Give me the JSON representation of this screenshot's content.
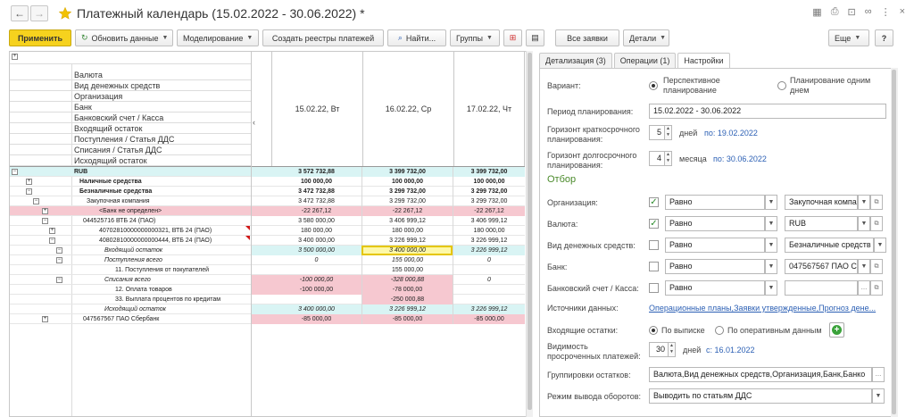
{
  "window": {
    "title": "Платежный календарь (15.02.2022 - 30.06.2022) *"
  },
  "toolbar": {
    "apply": "Применить",
    "refresh": "Обновить данные",
    "modeling": "Моделирование",
    "create_registers": "Создать реестры платежей",
    "find": "Найти...",
    "groups": "Группы",
    "all_requests": "Все заявки",
    "details": "Детали",
    "more": "Еще",
    "help": "?"
  },
  "grid": {
    "header_rows": [
      "Валюта",
      "Вид денежных средств",
      "Организация",
      "Банк",
      "Банковский счет / Касса",
      "Входящий остаток",
      "Поступления / Статья ДДС",
      "Списания / Статья ДДС",
      "Исходящий остаток"
    ],
    "dates": [
      "15.02.22, Вт",
      "16.02.22, Ср",
      "17.02.22, Чт"
    ],
    "rows": [
      {
        "label": "RUB",
        "v1": "3 572 732,88",
        "v2": "3 399 732,00",
        "v3": "3 399 732,00"
      },
      {
        "label": "Наличные средства",
        "v1": "100 000,00",
        "v2": "100 000,00",
        "v3": "100 000,00"
      },
      {
        "label": "Безналичные средства",
        "v1": "3 472 732,88",
        "v2": "3 299 732,00",
        "v3": "3 299 732,00"
      },
      {
        "label": "Закупочная компания",
        "v1": "3 472 732,88",
        "v2": "3 299 732,00",
        "v3": "3 299 732,00"
      },
      {
        "label": "<Банк не определен>",
        "v1": "-22 267,12",
        "v2": "-22 267,12",
        "v3": "-22 267,12"
      },
      {
        "label": "044525716 ВТБ 24 (ПАО)",
        "v1": "3 580 000,00",
        "v2": "3 406 999,12",
        "v3": "3 406 999,12"
      },
      {
        "label": "40702810000000000321, ВТБ 24 (ПАО)",
        "v1": "180 000,00",
        "v2": "180 000,00",
        "v3": "180 000,00"
      },
      {
        "label": "40802810000000000444, ВТБ 24 (ПАО)",
        "v1": "3 400 000,00",
        "v2": "3 226 999,12",
        "v3": "3 226 999,12"
      },
      {
        "label": "Входящий остаток",
        "v1": "3 500 000,00",
        "v2": "3 400 000,00",
        "v3": "3 226 999,12"
      },
      {
        "label": "Поступления всего",
        "v1": "0",
        "v2": "155 000,00",
        "v3": "0"
      },
      {
        "label": "11. Поступления от покупателей",
        "v1": "",
        "v2": "155 000,00",
        "v3": ""
      },
      {
        "label": "Списания всего",
        "v1": "-100 000,00",
        "v2": "-328 000,88",
        "v3": "0"
      },
      {
        "label": "12. Оплата товаров",
        "v1": "-100 000,00",
        "v2": "-78 000,00",
        "v3": ""
      },
      {
        "label": "33. Выплата процентов по кредитам",
        "v1": "",
        "v2": "-250 000,88",
        "v3": ""
      },
      {
        "label": "Исходящий остаток",
        "v1": "3 400 000,00",
        "v2": "3 226 999,12",
        "v3": "3 226 999,12"
      },
      {
        "label": "047567567 ПАО Сбербанк",
        "v1": "-85 000,00",
        "v2": "-85 000,00",
        "v3": "-85 000,00"
      }
    ]
  },
  "panel": {
    "tabs": [
      "Детализация (3)",
      "Операции (1)",
      "Настройки"
    ],
    "variant_label": "Вариант:",
    "variant_opt1": "Перспективное планирование",
    "variant_opt2": "Планирование одним днем",
    "period_label": "Период планирования:",
    "period_value": "15.02.2022 - 30.06.2022",
    "short_label": "Горизонт краткосрочного планирования:",
    "short_value": "5",
    "short_unit": "дней",
    "short_link": "по: 19.02.2022",
    "long_label": "Горизонт долгосрочного планирования:",
    "long_value": "4",
    "long_unit": "месяца",
    "long_link": "по: 30.06.2022",
    "filter_title": "Отбор",
    "filters": [
      {
        "label": "Организация:",
        "checked": "✓",
        "cond": "Равно",
        "value": "Закупочная компа"
      },
      {
        "label": "Валюта:",
        "checked": "✓",
        "cond": "Равно",
        "value": "RUB"
      },
      {
        "label": "Вид денежных средств:",
        "checked": "",
        "cond": "Равно",
        "value": "Безналичные средств"
      },
      {
        "label": "Банк:",
        "checked": "",
        "cond": "Равно",
        "value": "047567567 ПАО С"
      },
      {
        "label": "Банковский счет / Касса:",
        "checked": "",
        "cond": "Равно",
        "value": ""
      }
    ],
    "sources_label": "Источники данных:",
    "sources_link": "Операционные планы,Заявки утвержденные,Прогноз дене...",
    "incoming_label": "Входящие остатки:",
    "incoming_opt1": "По выписке",
    "incoming_opt2": "По оперативным данным",
    "visibility_label": "Видимость просроченных платежей:",
    "visibility_value": "30",
    "visibility_unit": "дней",
    "visibility_link": "с: 16.01.2022",
    "groupings_label": "Группировки остатков:",
    "groupings_value": "Валюта,Вид денежных средств,Организация,Банк,Банко",
    "mode_label": "Режим вывода оборотов:",
    "mode_value": "Выводить по статьям ДДС"
  },
  "colors": {
    "apply_button": "#f6d21e",
    "cyan_row": "#d9f4f4",
    "pink_row": "#f6c8d0",
    "selected_cell": "#fdf8a8"
  }
}
